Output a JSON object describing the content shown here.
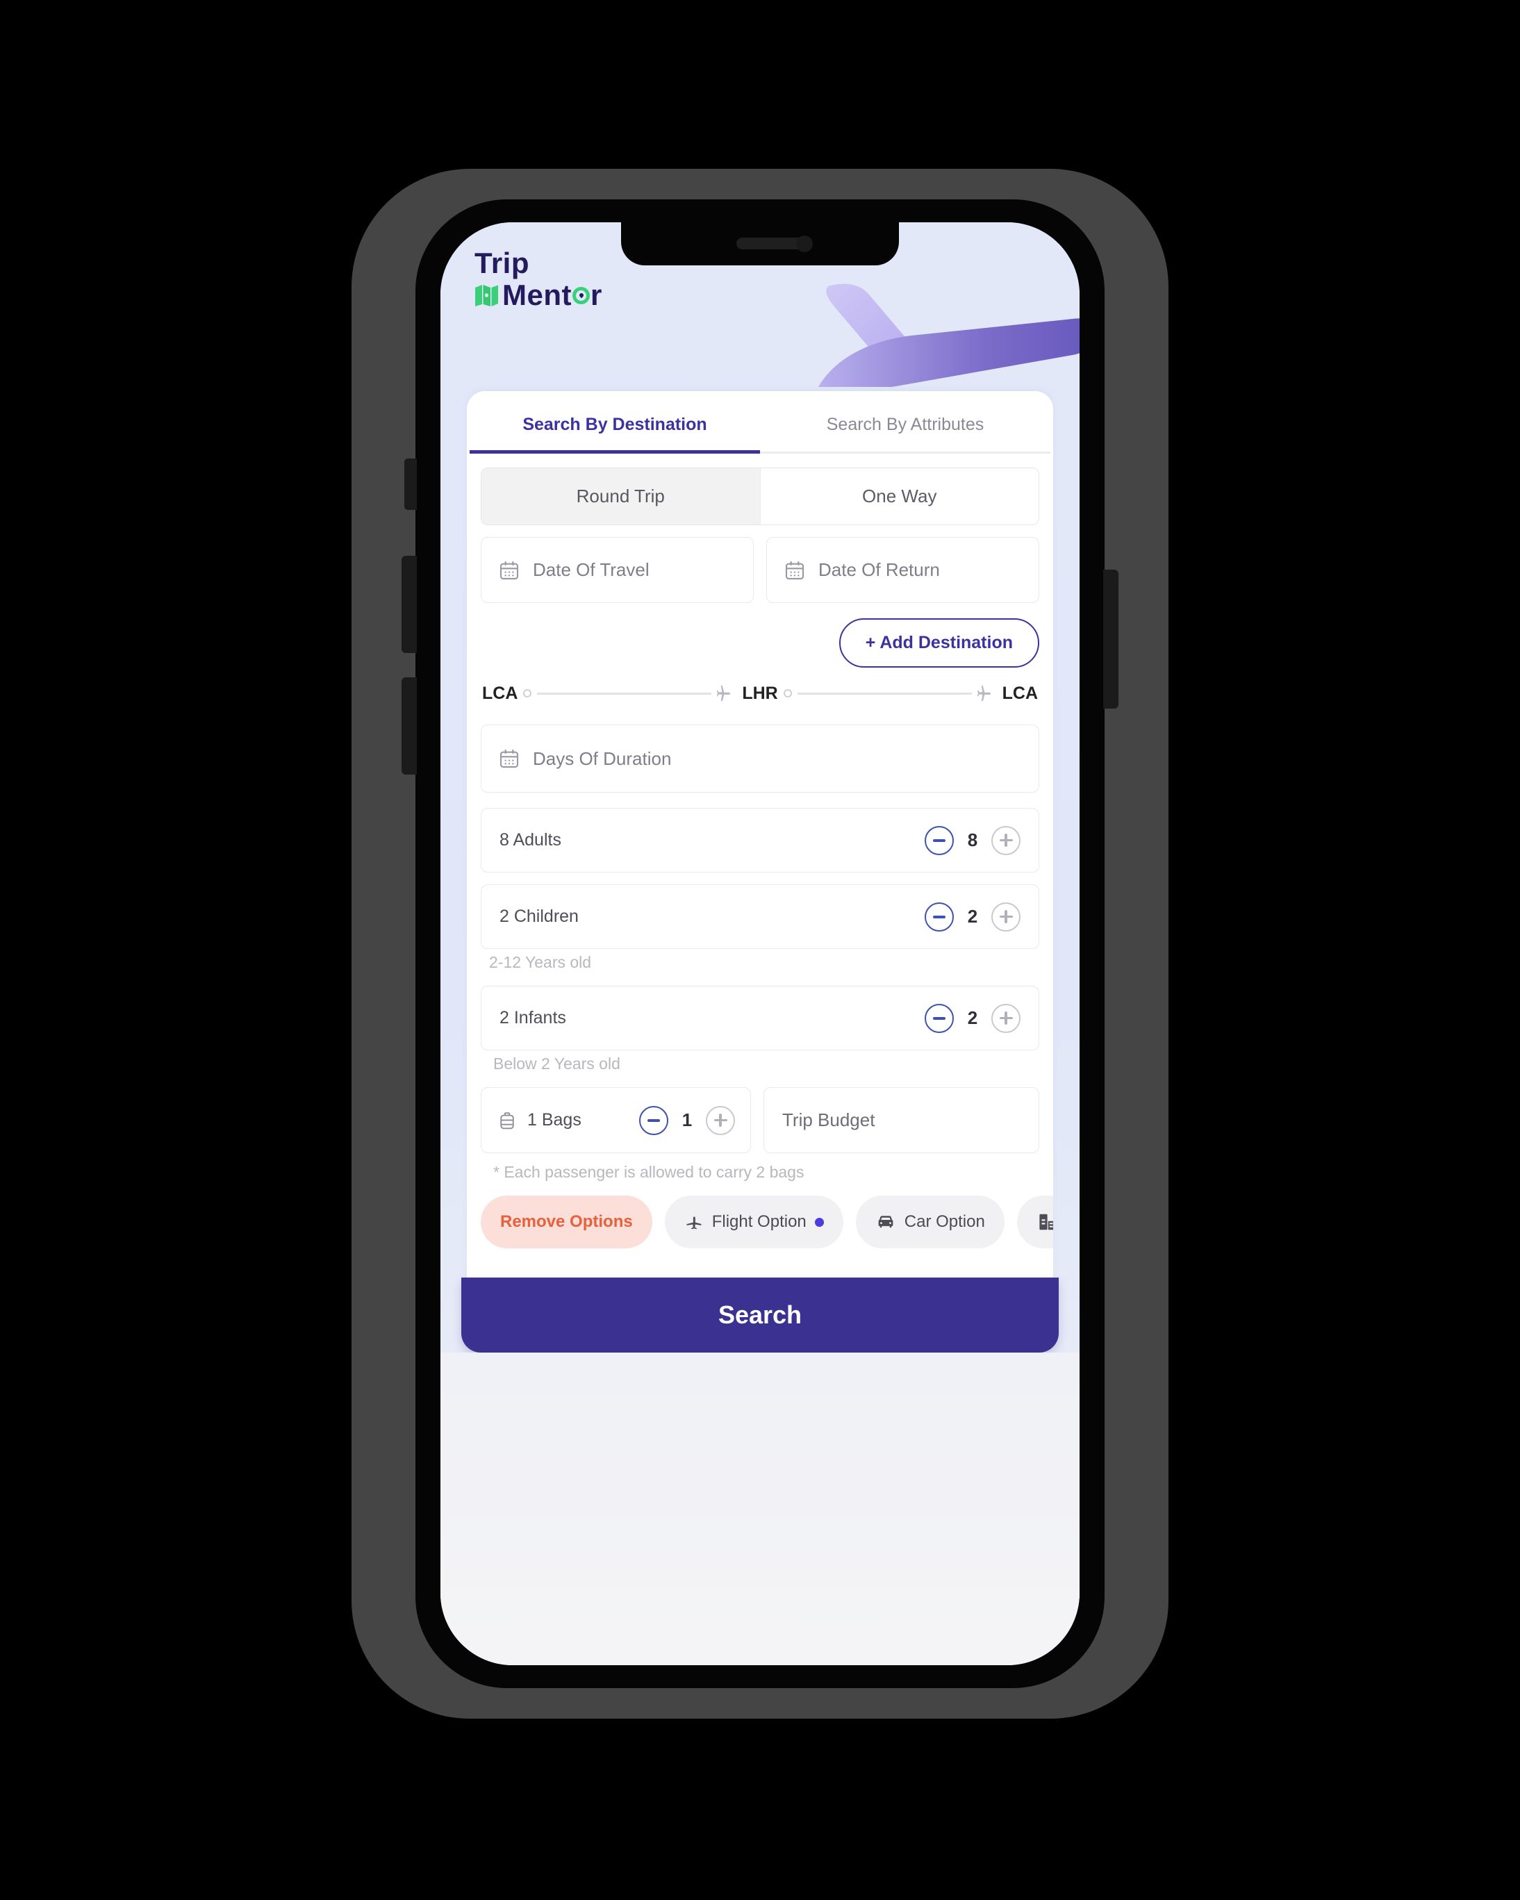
{
  "brand": {
    "name_line1": "Trip",
    "name_line2": "Mentor",
    "map_icon": "map-icon",
    "primary_color": "#3b32a0",
    "accent_green": "#3ad07a"
  },
  "tabs": [
    {
      "label": "Search By Destination",
      "active": true
    },
    {
      "label": "Search By Attributes",
      "active": false
    }
  ],
  "trip_type": {
    "options": [
      {
        "label": "Round Trip",
        "selected": true
      },
      {
        "label": "One Way",
        "selected": false
      }
    ]
  },
  "dates": {
    "travel": {
      "placeholder": "Date Of Travel",
      "value": "",
      "icon": "calendar-icon"
    },
    "return": {
      "placeholder": "Date Of Return",
      "value": "",
      "icon": "calendar-icon"
    }
  },
  "add_destination": {
    "label": "+ Add Destination"
  },
  "route": {
    "stops": [
      "LCA",
      "LHR",
      "LCA"
    ],
    "segment_icon": "airplane-icon"
  },
  "duration": {
    "placeholder": "Days Of Duration",
    "icon": "calendar-icon"
  },
  "passengers": [
    {
      "label": "8 Adults",
      "value": "8",
      "note": ""
    },
    {
      "label": "2 Children",
      "value": "2",
      "note": "2-12 Years old"
    },
    {
      "label": "2 Infants",
      "value": "2",
      "note": "Below 2 Years old"
    }
  ],
  "bags": {
    "label": "1  Bags",
    "value": "1",
    "icon": "suitcase-icon",
    "note": "* Each passenger is allowed to carry 2 bags"
  },
  "budget": {
    "placeholder": "Trip Budget",
    "value": ""
  },
  "option_chips": [
    {
      "label": "Remove Options",
      "style": "danger",
      "icon": "",
      "dot": false
    },
    {
      "label": "Flight Option",
      "style": "default",
      "icon": "airplane-icon",
      "dot": true
    },
    {
      "label": "Car Option",
      "style": "default",
      "icon": "car-icon",
      "dot": false
    },
    {
      "label": "",
      "style": "default",
      "icon": "hotel-icon",
      "dot": false
    }
  ],
  "search_button": {
    "label": "Search",
    "color": "#3a3191"
  }
}
